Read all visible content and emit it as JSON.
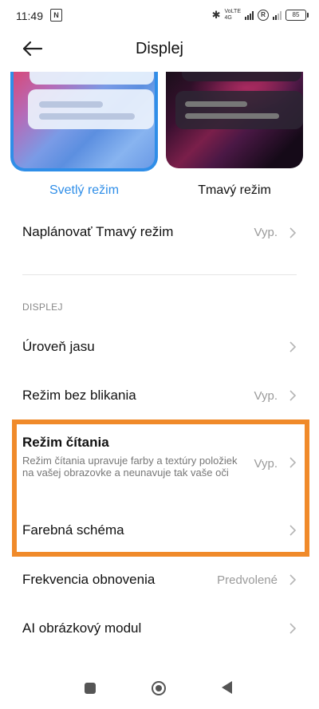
{
  "status_bar": {
    "time": "11:49",
    "nfc_glyph": "N",
    "network_top": "VoLTE",
    "network_bottom": "4G",
    "roaming_glyph": "R",
    "battery": "85"
  },
  "header": {
    "title": "Displej",
    "back_icon": "arrow-left-icon"
  },
  "themes": {
    "light_label": "Svetlý režim",
    "dark_label": "Tmavý režim",
    "selected": "light",
    "accent_color": "#2f8ee8"
  },
  "rows": {
    "schedule": {
      "title": "Naplánovať Tmavý režim",
      "value": "Vyp."
    },
    "section_label": "DISPLEJ",
    "brightness": {
      "title": "Úroveň jasu"
    },
    "flicker_free": {
      "title": "Režim bez blikania",
      "value": "Vyp."
    },
    "reading": {
      "title": "Režim čítania",
      "subtitle": "Režim čítania upravuje farby a textúry položiek na vašej obrazovke a neunavuje tak vaše oči",
      "value": "Vyp."
    },
    "color_scheme": {
      "title": "Farebná schéma"
    },
    "refresh_rate": {
      "title": "Frekvencia obnovenia",
      "value": "Predvolené"
    },
    "ai_image": {
      "title": "AI obrázkový modul"
    }
  },
  "highlight_color": "#f08a2a"
}
